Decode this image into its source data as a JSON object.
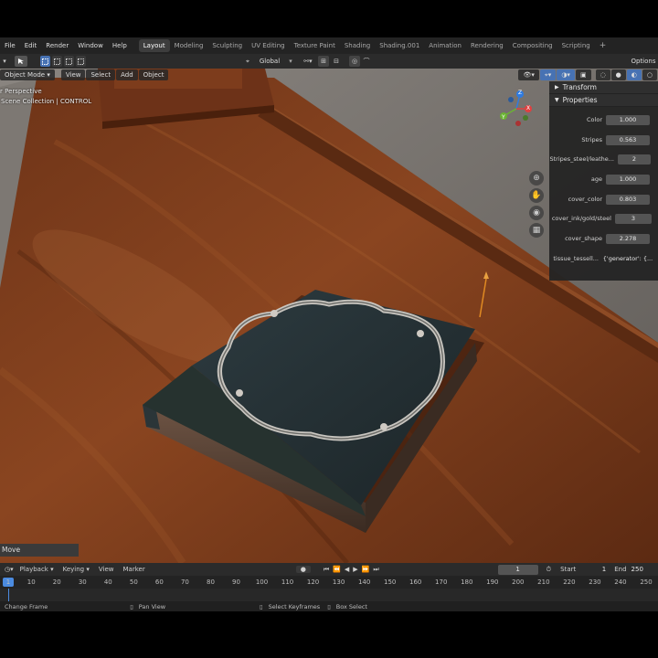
{
  "menu": [
    "File",
    "Edit",
    "Render",
    "Window",
    "Help"
  ],
  "workspaces": [
    "Layout",
    "Modeling",
    "Sculpting",
    "UV Editing",
    "Texture Paint",
    "Shading",
    "Shading.001",
    "Animation",
    "Rendering",
    "Compositing",
    "Scripting"
  ],
  "active_workspace": "Layout",
  "options_label": "Options",
  "toolbar": {
    "transform_orientation": "Global"
  },
  "viewport_header": {
    "mode": "Object Mode",
    "view": "View",
    "select": "Select",
    "add": "Add",
    "object": "Object"
  },
  "viewport_overlay": {
    "perspective": "r Perspective",
    "collection": "Scene Collection | CONTROL"
  },
  "gizmo_axes": {
    "z": "Z",
    "y": "Y",
    "x": "X"
  },
  "npanel": {
    "transform": "Transform",
    "properties": "Properties",
    "rows": [
      {
        "label": "Color",
        "value": "1.000"
      },
      {
        "label": "Stripes",
        "value": "0.563"
      },
      {
        "label": "Stripes_steel/leathe...",
        "value": "2"
      },
      {
        "label": "age",
        "value": "1.000"
      },
      {
        "label": "cover_color",
        "value": "0.803"
      },
      {
        "label": "cover_ink/gold/steel",
        "value": "3"
      },
      {
        "label": "cover_shape",
        "value": "2.278"
      },
      {
        "label": "tissue_tessell...",
        "value": "{'generator': {..."
      }
    ]
  },
  "last_operator": "Move",
  "timeline": {
    "menus": [
      "Playback",
      "Keying",
      "View",
      "Marker"
    ],
    "current_frame": "1",
    "start_label": "Start",
    "start": "1",
    "end_label": "End",
    "end": "250",
    "ticks": [
      "1",
      "10",
      "20",
      "30",
      "40",
      "50",
      "60",
      "70",
      "80",
      "90",
      "100",
      "110",
      "120",
      "130",
      "140",
      "150",
      "160",
      "170",
      "180",
      "190",
      "200",
      "210",
      "220",
      "230",
      "240",
      "250"
    ]
  },
  "statusbar": {
    "change_frame": "Change Frame",
    "pan_view": "Pan View",
    "select_keyframes": "Select Keyframes",
    "box_select": "Box Select"
  },
  "colors": {
    "accent": "#4772b3",
    "playhead": "#4b8be0",
    "panel_bg": "#242424",
    "field_bg": "#545454"
  }
}
